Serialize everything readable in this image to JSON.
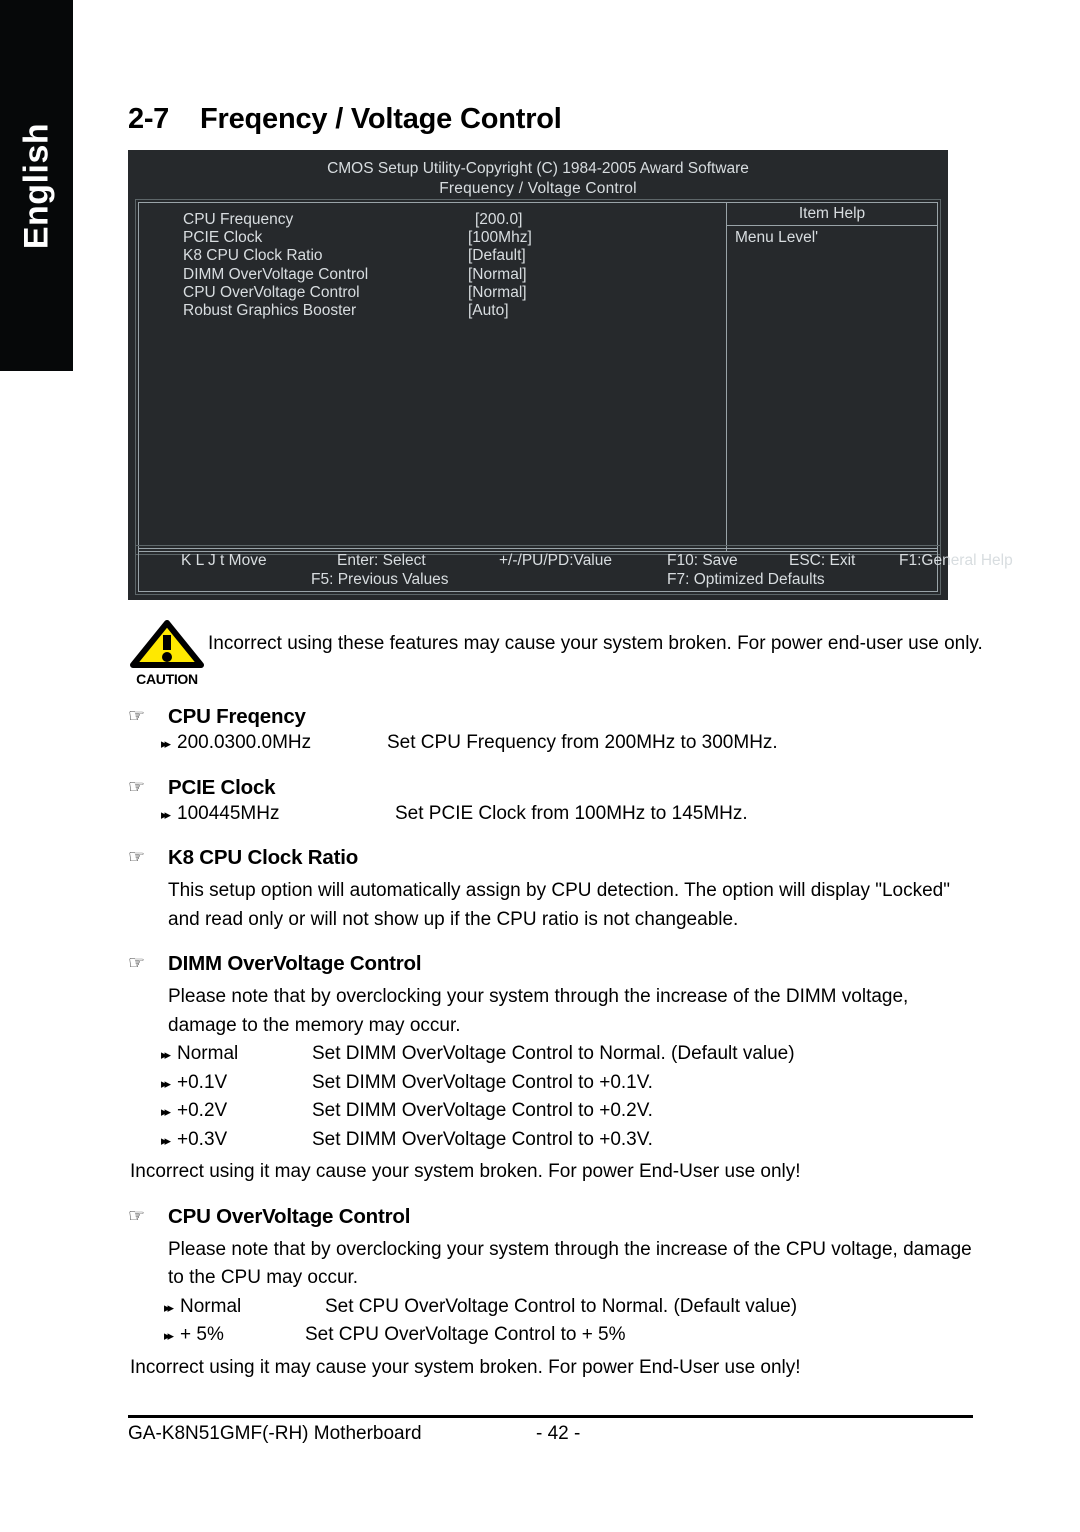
{
  "sidebar": {
    "language_label": "English"
  },
  "heading": {
    "number": "2-7",
    "title": "Freqency / Voltage Control"
  },
  "bios": {
    "title_line1": "CMOS Setup Utility-Copyright (C) 1984-2005 Award Software",
    "title_line2": "Frequency / Voltage Control",
    "items": [
      {
        "name": "CPU Frequency",
        "value": "[200.0]"
      },
      {
        "name": "PCIE Clock",
        "value": "[100Mhz]"
      },
      {
        "name": "K8 CPU Clock Ratio",
        "value": "[Default]"
      },
      {
        "name": "DIMM OverVoltage Control",
        "value": "[Normal]"
      },
      {
        "name": "CPU OverVoltage Control",
        "value": "[Normal]"
      },
      {
        "name": "Robust Graphics Booster",
        "value": "[Auto]"
      }
    ],
    "help_title": "Item Help",
    "help_body": "Menu Level'",
    "footer": {
      "move": "K L J t Move",
      "enter": "Enter: Select",
      "value": "+/-/PU/PD:Value",
      "save": "F10: Save",
      "exit": "ESC: Exit",
      "general_help": "F1:General Help",
      "previous": "F5: Previous Values",
      "optimized": "F7: Optimized Defaults"
    }
  },
  "caution": {
    "word": "CAUTION",
    "text": "Incorrect using these features may cause your system broken. For power end-user use only."
  },
  "icons": {
    "hand": "☞",
    "arrow": "▸▸"
  },
  "sections": [
    {
      "title": "CPU Freqency",
      "options": [
        {
          "label": "200.0300.0MHz",
          "desc": "Set CPU Frequency from 200MHz to 300MHz."
        }
      ]
    },
    {
      "title": "PCIE Clock",
      "options": [
        {
          "label": "100445MHz",
          "desc": "Set PCIE Clock from 100MHz to 145MHz."
        }
      ]
    },
    {
      "title": "K8 CPU Clock Ratio",
      "paragraph": "This setup option will automatically assign by CPU detection. The option will display \"Locked\" and read only or will not show up if the CPU ratio is not changeable.",
      "options": []
    },
    {
      "title": "DIMM OverVoltage Control",
      "paragraph": "Please note that by overclocking your system through the increase of the DIMM voltage, damage to the memory may occur.",
      "options": [
        {
          "label": "Normal",
          "desc": "Set DIMM OverVoltage Control to Normal. (Default value)"
        },
        {
          "label": "+0.1V",
          "desc": "Set DIMM OverVoltage Control to +0.1V."
        },
        {
          "label": "+0.2V",
          "desc": "Set DIMM OverVoltage Control to +0.2V."
        },
        {
          "label": "+0.3V",
          "desc": "Set DIMM OverVoltage Control to +0.3V."
        }
      ],
      "notice": "Incorrect using it may cause your system broken. For power End-User use only!"
    },
    {
      "title": "CPU OverVoltage Control",
      "paragraph": "Please note that by overclocking your system through the increase of the CPU voltage, damage to the CPU may occur.",
      "options": [
        {
          "label": "Normal",
          "desc": "Set CPU OverVoltage Control to Normal. (Default value)"
        },
        {
          "label": "+ 5%",
          "desc": "Set CPU OverVoltage Control to + 5%"
        }
      ],
      "notice": "Incorrect using it may cause your system broken. For power End-User use only!"
    }
  ],
  "footer": {
    "document": "GA-K8N51GMF(-RH) Motherboard",
    "page": "- 42 -"
  }
}
